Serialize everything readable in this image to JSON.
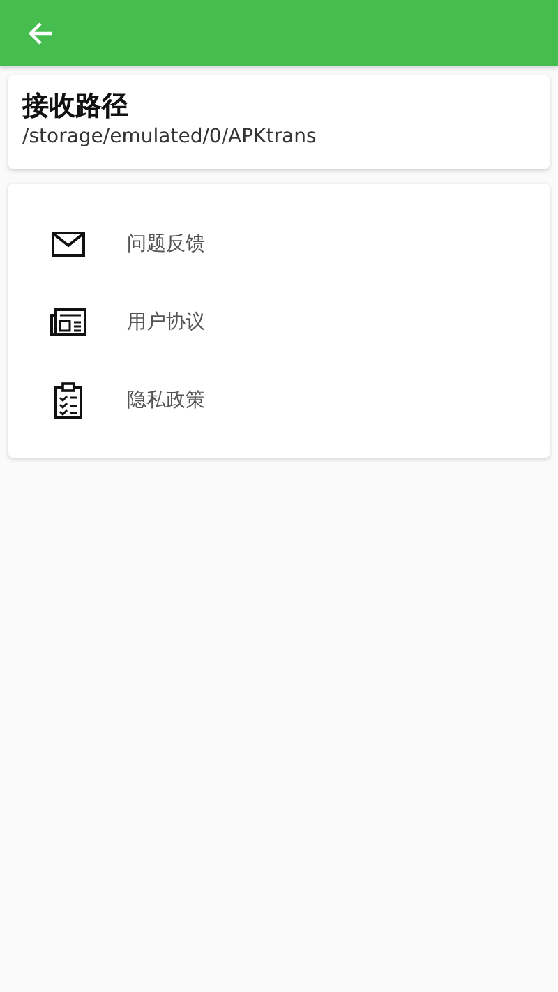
{
  "app_bar": {
    "back": true
  },
  "path_card": {
    "title": "接收路径",
    "path": "/storage/emulated/0/APKtrans"
  },
  "menu": [
    {
      "kind": "mail",
      "label": "问题反馈"
    },
    {
      "kind": "newspaper",
      "label": "用户协议"
    },
    {
      "kind": "clipboard",
      "label": "隐私政策"
    }
  ]
}
